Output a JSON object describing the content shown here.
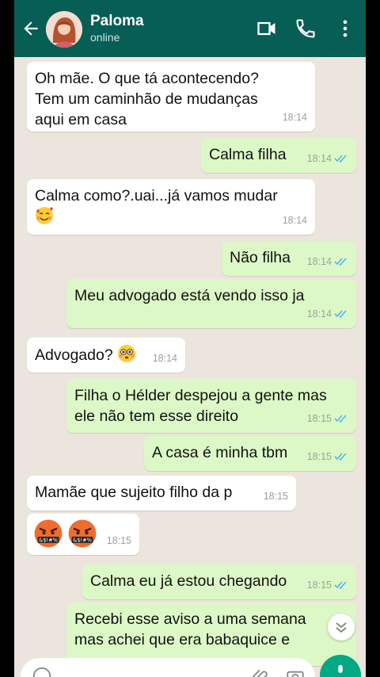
{
  "header": {
    "contact_name": "Paloma",
    "contact_status": "online",
    "icons": [
      "back-arrow-icon",
      "video-call-icon",
      "phone-icon",
      "more-options-icon"
    ]
  },
  "colors": {
    "header": "#075e54",
    "chat_background": "#ece5dd",
    "incoming_bubble": "#ffffff",
    "outgoing_bubble": "#dcf8c6",
    "read_ticks": "#4fb6ec",
    "mic_button": "#00a884"
  },
  "messages": [
    {
      "dir": "in",
      "text": "Oh mãe. O que tá acontecendo?\nTem um caminhão de mudanças\naqui em casa",
      "time": "18:14"
    },
    {
      "dir": "out",
      "text": "Calma filha",
      "time": "18:14"
    },
    {
      "dir": "in",
      "text": "Calma como?.uai...já vamos mudar",
      "emoji": "smiling-face-with-hearts",
      "time": "18:14"
    },
    {
      "dir": "out",
      "text": "Não filha",
      "time": "18:14"
    },
    {
      "dir": "out",
      "text": "Meu advogado está vendo isso ja",
      "time": "18:14"
    },
    {
      "dir": "in",
      "text": "Advogado?",
      "emoji": "flushed-face",
      "time": "18:14"
    },
    {
      "dir": "out",
      "text": "Filha o Hélder despejou a gente mas\nele não tem esse direito",
      "time": "18:15"
    },
    {
      "dir": "out",
      "text": "A casa é minha tbm",
      "time": "18:15"
    },
    {
      "dir": "in",
      "text": "Mamãe que sujeito filho da p",
      "time": "18:15"
    },
    {
      "dir": "in",
      "emoji": "face-with-symbols-on-mouth x2",
      "time": "18:15"
    },
    {
      "dir": "out",
      "text": "Calma eu já estou chegando",
      "time": "18:15"
    },
    {
      "dir": "out",
      "text": "Recebi esse aviso a uma semana\nmas achei que era babaquice e",
      "time": ""
    }
  ]
}
